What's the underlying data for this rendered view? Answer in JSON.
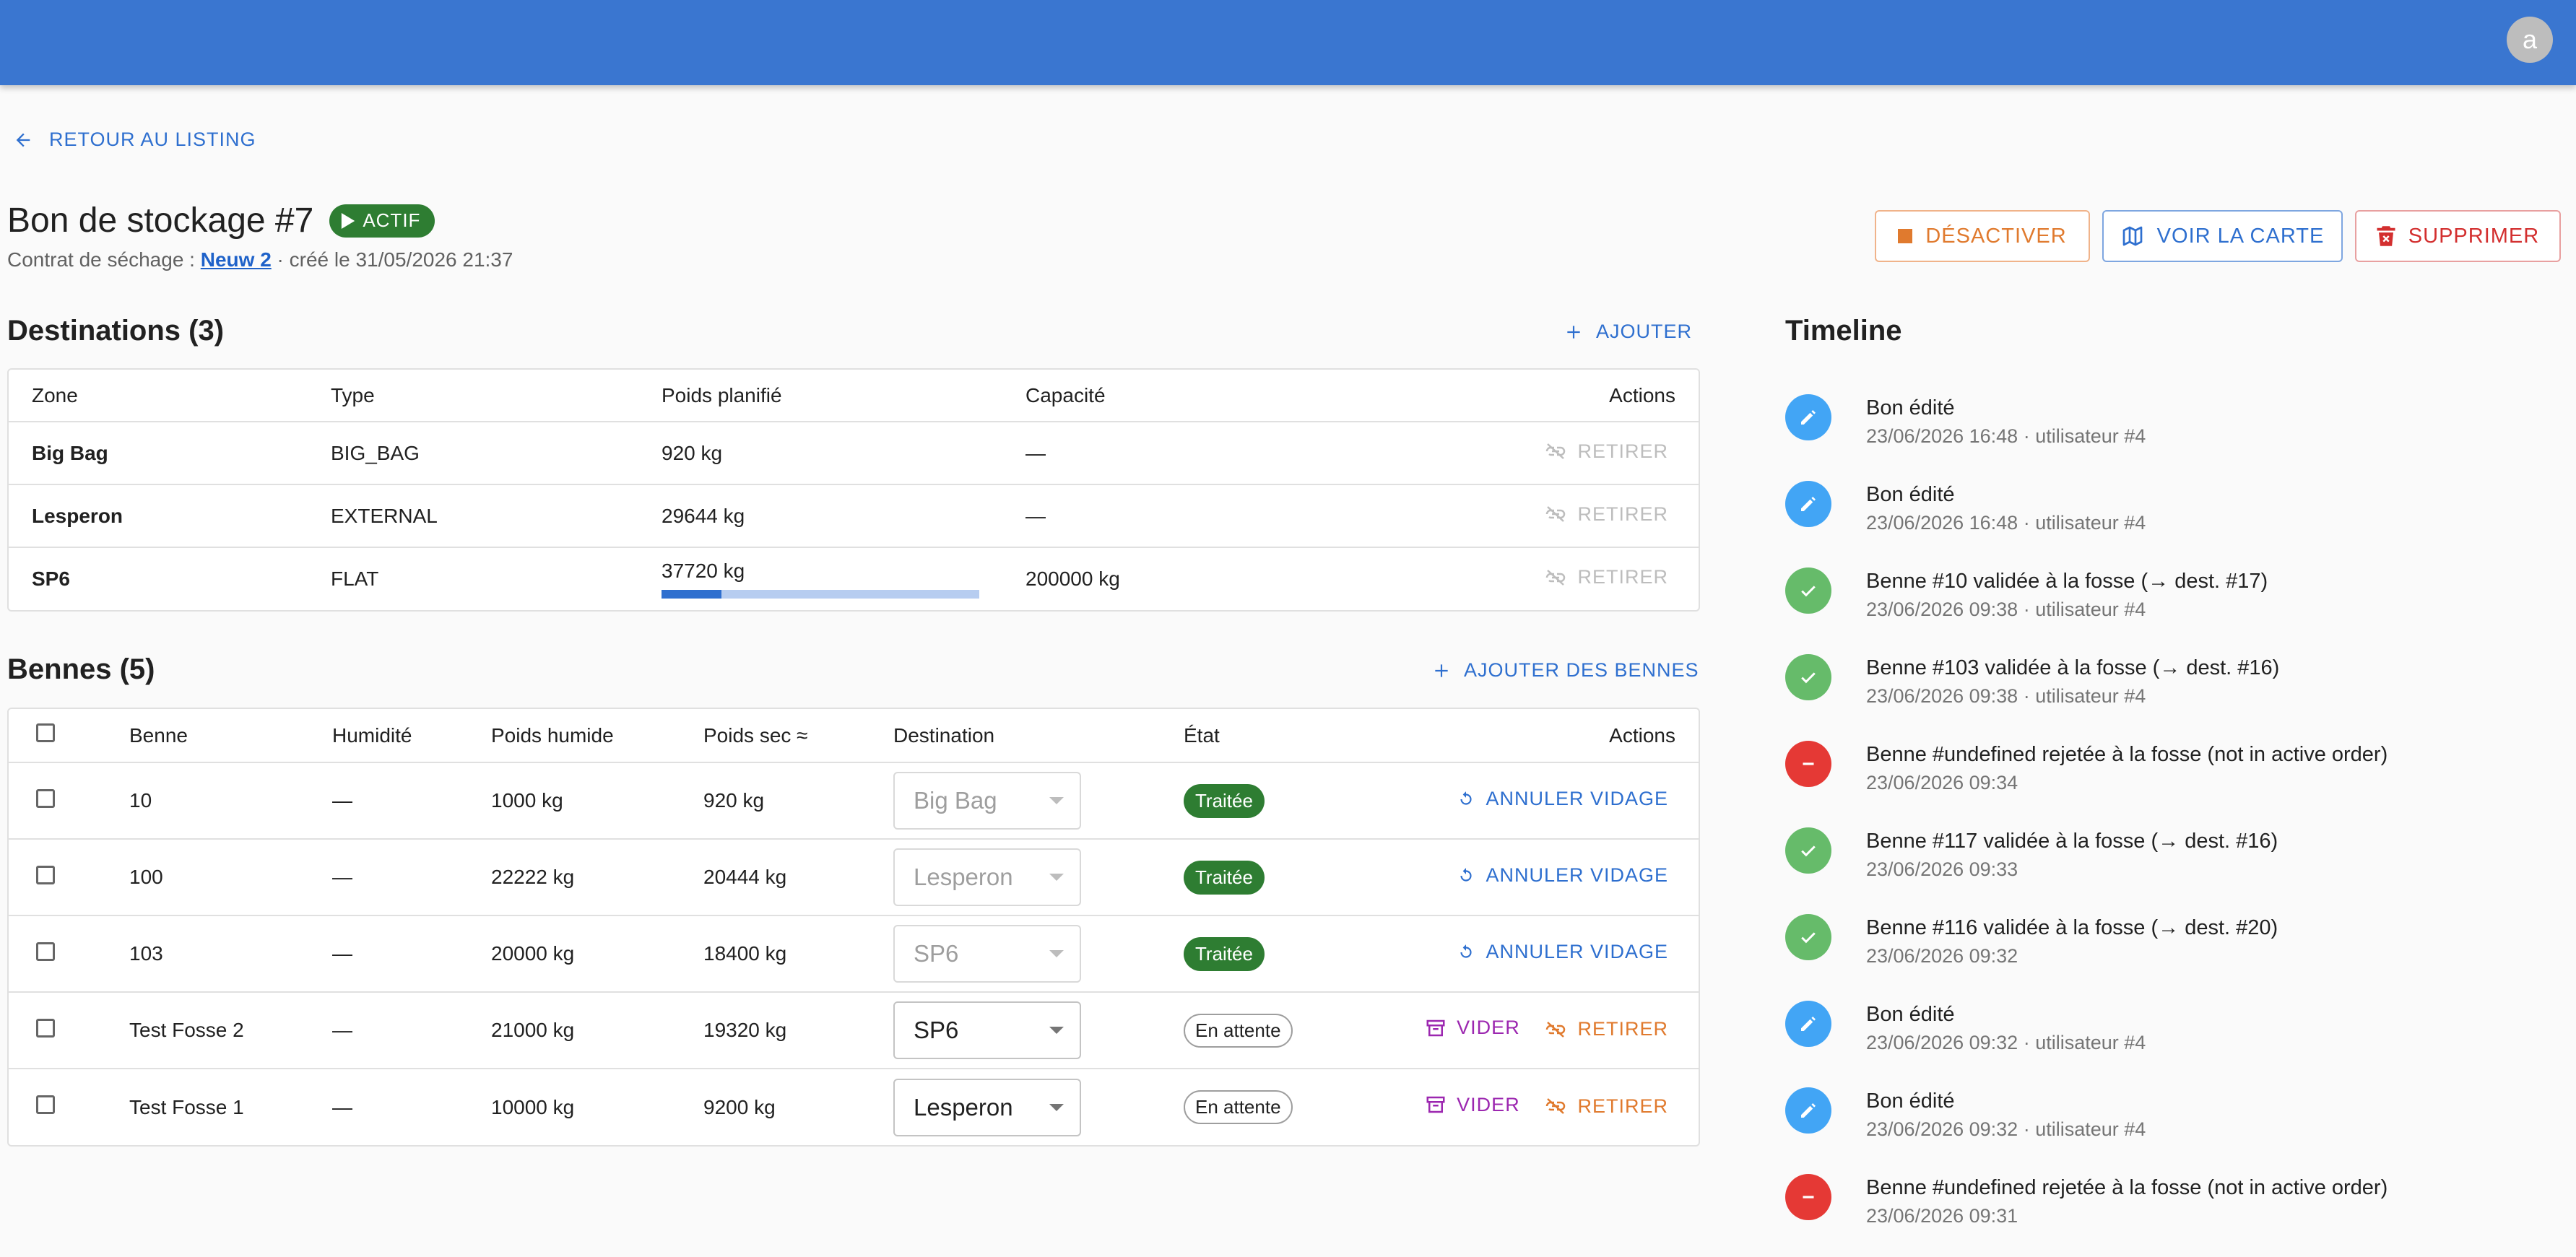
{
  "header": {
    "avatar_letter": "a"
  },
  "back_link": "RETOUR AU LISTING",
  "page": {
    "title": "Bon de stockage #7",
    "status": "ACTIF",
    "subtitle_prefix": "Contrat de séchage : ",
    "contract_link": "Neuw 2",
    "subtitle_suffix": " · créé le 31/05/2026 21:37"
  },
  "actions": {
    "deactivate": "DÉSACTIVER",
    "map": "VOIR LA CARTE",
    "delete": "SUPPRIMER"
  },
  "destinations": {
    "title": "Destinations (3)",
    "add_label": "AJOUTER",
    "columns": [
      "Zone",
      "Type",
      "Poids planifié",
      "Capacité",
      "Actions"
    ],
    "rows": [
      {
        "zone": "Big Bag",
        "type": "BIG_BAG",
        "weight": "920 kg",
        "capacity": "—",
        "action": "RETIRER"
      },
      {
        "zone": "Lesperon",
        "type": "EXTERNAL",
        "weight": "29644 kg",
        "capacity": "—",
        "action": "RETIRER"
      },
      {
        "zone": "SP6",
        "type": "FLAT",
        "weight": "37720 kg",
        "capacity": "200000 kg",
        "action": "RETIRER",
        "fill_fraction": 0.1886
      }
    ]
  },
  "bennes": {
    "title": "Bennes (5)",
    "add_label": "AJOUTER DES BENNES",
    "columns": [
      "Benne",
      "Humidité",
      "Poids humide",
      "Poids sec ≈",
      "Destination",
      "État",
      "Actions"
    ],
    "rows": [
      {
        "benne": "10",
        "humidity": "—",
        "wet": "1000 kg",
        "dry": "920 kg",
        "destination": "Big Bag",
        "state": "Traitée",
        "action": "ANNULER VIDAGE"
      },
      {
        "benne": "100",
        "humidity": "—",
        "wet": "22222 kg",
        "dry": "20444 kg",
        "destination": "Lesperon",
        "state": "Traitée",
        "action": "ANNULER VIDAGE"
      },
      {
        "benne": "103",
        "humidity": "—",
        "wet": "20000 kg",
        "dry": "18400 kg",
        "destination": "SP6",
        "state": "Traitée",
        "action": "ANNULER VIDAGE"
      },
      {
        "benne": "Test Fosse 2",
        "humidity": "—",
        "wet": "21000 kg",
        "dry": "19320 kg",
        "destination": "SP6",
        "state": "En attente",
        "action_empty": "VIDER",
        "action_remove": "RETIRER"
      },
      {
        "benne": "Test Fosse 1",
        "humidity": "—",
        "wet": "10000 kg",
        "dry": "9200 kg",
        "destination": "Lesperon",
        "state": "En attente",
        "action_empty": "VIDER",
        "action_remove": "RETIRER"
      }
    ]
  },
  "timeline": {
    "title": "Timeline",
    "items": [
      {
        "kind": "edit",
        "title": "Bon édité",
        "sub": "23/06/2026 16:48 · utilisateur #4"
      },
      {
        "kind": "edit",
        "title": "Bon édité",
        "sub": "23/06/2026 16:48 · utilisateur #4"
      },
      {
        "kind": "ok",
        "title": "Benne #10 validée à la fosse (→ dest. #17)",
        "sub": "23/06/2026 09:38 · utilisateur #4"
      },
      {
        "kind": "ok",
        "title": "Benne #103 validée à la fosse (→ dest. #16)",
        "sub": "23/06/2026 09:38 · utilisateur #4"
      },
      {
        "kind": "error",
        "title": "Benne #undefined rejetée à la fosse (not in active order)",
        "sub": "23/06/2026 09:34"
      },
      {
        "kind": "ok",
        "title": "Benne #117 validée à la fosse (→ dest. #16)",
        "sub": "23/06/2026 09:33"
      },
      {
        "kind": "ok",
        "title": "Benne #116 validée à la fosse (→ dest. #20)",
        "sub": "23/06/2026 09:32"
      },
      {
        "kind": "edit",
        "title": "Bon édité",
        "sub": "23/06/2026 09:32 · utilisateur #4"
      },
      {
        "kind": "edit",
        "title": "Bon édité",
        "sub": "23/06/2026 09:32 · utilisateur #4"
      },
      {
        "kind": "error",
        "title": "Benne #undefined rejetée à la fosse (not in active order)",
        "sub": "23/06/2026 09:31"
      }
    ]
  },
  "colors": {
    "app_bar": "#3a76d0",
    "primary": "#2e6fcf",
    "success": "#2e7d32",
    "warning": "#e07a2e",
    "danger": "#d32f2f",
    "purple": "#9c27b0",
    "tl_edit": "#42a5f5",
    "tl_ok": "#66bb6a",
    "tl_error": "#e53935"
  }
}
